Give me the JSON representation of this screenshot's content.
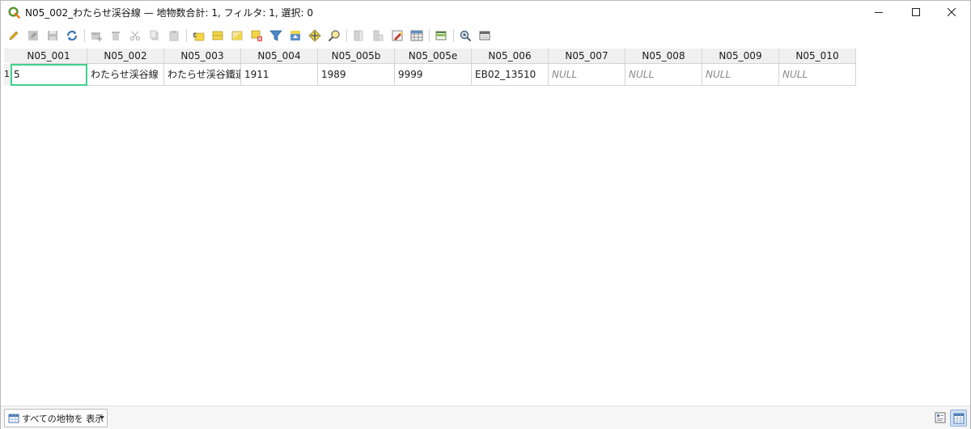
{
  "window": {
    "title": "N05_002_わたらせ渓谷線 — 地物数合計: 1, フィルタ: 1, 選択: 0"
  },
  "toolbar": {
    "buttons": [
      "pencil-icon",
      "save-edits-icon",
      "save-icon",
      "reload-icon",
      "add-feature-icon",
      "delete-feature-icon",
      "cut-icon",
      "copy-icon",
      "paste-icon",
      "select-expression-icon",
      "select-all-icon",
      "invert-selection-icon",
      "deselect-icon",
      "filter-icon",
      "move-selection-top-icon",
      "pan-to-selection-icon",
      "zoom-to-selection-icon",
      "new-field-icon",
      "delete-field-icon",
      "organize-columns-icon",
      "field-calculator-icon",
      "conditional-format-icon",
      "actions-icon",
      "dock-icon"
    ]
  },
  "table": {
    "columns": [
      "N05_001",
      "N05_002",
      "N05_003",
      "N05_004",
      "N05_005b",
      "N05_005e",
      "N05_006",
      "N05_007",
      "N05_008",
      "N05_009",
      "N05_010"
    ],
    "rows": [
      {
        "id": "1",
        "cells": [
          "5",
          "わたらせ渓谷線",
          "わたらせ渓谷鐵道",
          "1911",
          "1989",
          "9999",
          "EB02_13510",
          "NULL",
          "NULL",
          "NULL",
          "NULL"
        ]
      }
    ]
  },
  "bottombar": {
    "filter_label": "すべての地物を 表示"
  },
  "colors": {
    "selection_outline": "#3fd18c",
    "header_bg": "#f0f0f0",
    "null_text": "#8a8a8a"
  }
}
